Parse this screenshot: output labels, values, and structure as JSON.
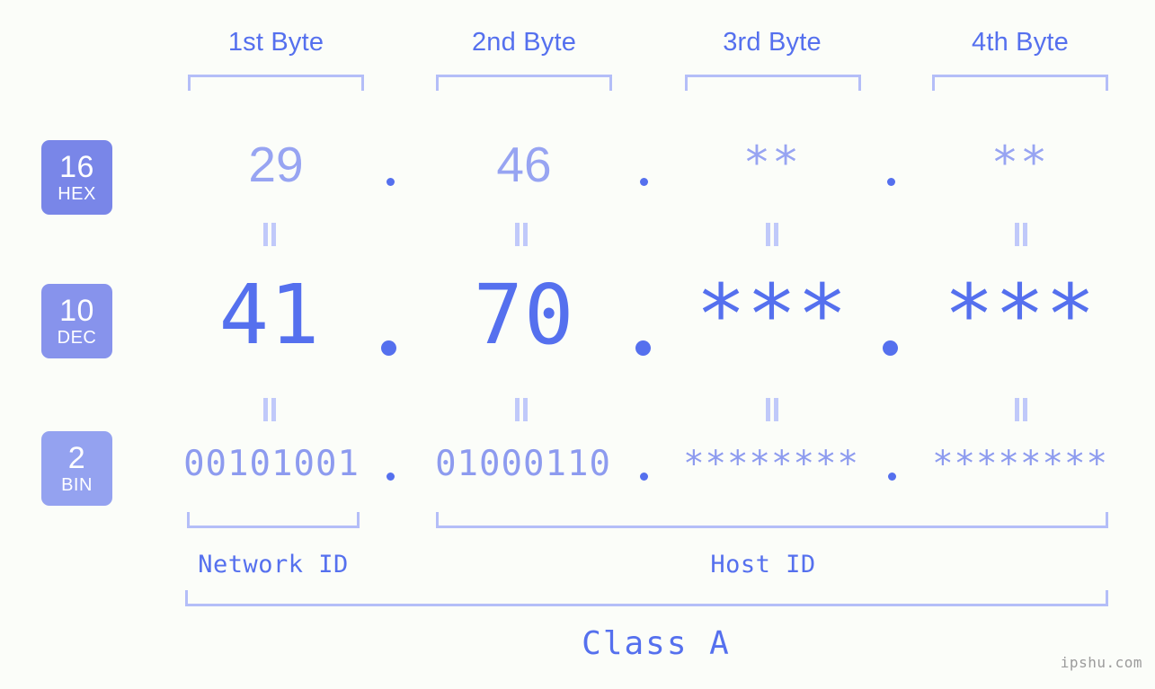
{
  "header": {
    "byte_labels": [
      "1st Byte",
      "2nd Byte",
      "3rd Byte",
      "4th Byte"
    ]
  },
  "bases": [
    {
      "number": "16",
      "name": "HEX",
      "color": "#7986e8"
    },
    {
      "number": "10",
      "name": "DEC",
      "color": "#8793ec"
    },
    {
      "number": "2",
      "name": "BIN",
      "color": "#94a2f0"
    }
  ],
  "rows": {
    "hex": {
      "base_number": "16",
      "base_name": "HEX",
      "values": [
        "29",
        "46",
        "**",
        "**"
      ],
      "separator": "."
    },
    "dec": {
      "base_number": "10",
      "base_name": "DEC",
      "values": [
        "41",
        "70",
        "***",
        "***"
      ],
      "separator": "."
    },
    "bin": {
      "base_number": "2",
      "base_name": "BIN",
      "values": [
        "00101001",
        "01000110",
        "********",
        "********"
      ],
      "separator": "."
    }
  },
  "equals_symbol": "=",
  "footer": {
    "network_id_label": "Network ID",
    "host_id_label": "Host ID",
    "class_label": "Class A",
    "watermark": "ipshu.com"
  },
  "colors": {
    "background": "#fbfdf9",
    "accent_strong": "#5570ee",
    "accent_light": "#97a4f2",
    "bracket": "#b4bef8",
    "equals": "#c0c9fa",
    "watermark": "#9b9b9b"
  }
}
